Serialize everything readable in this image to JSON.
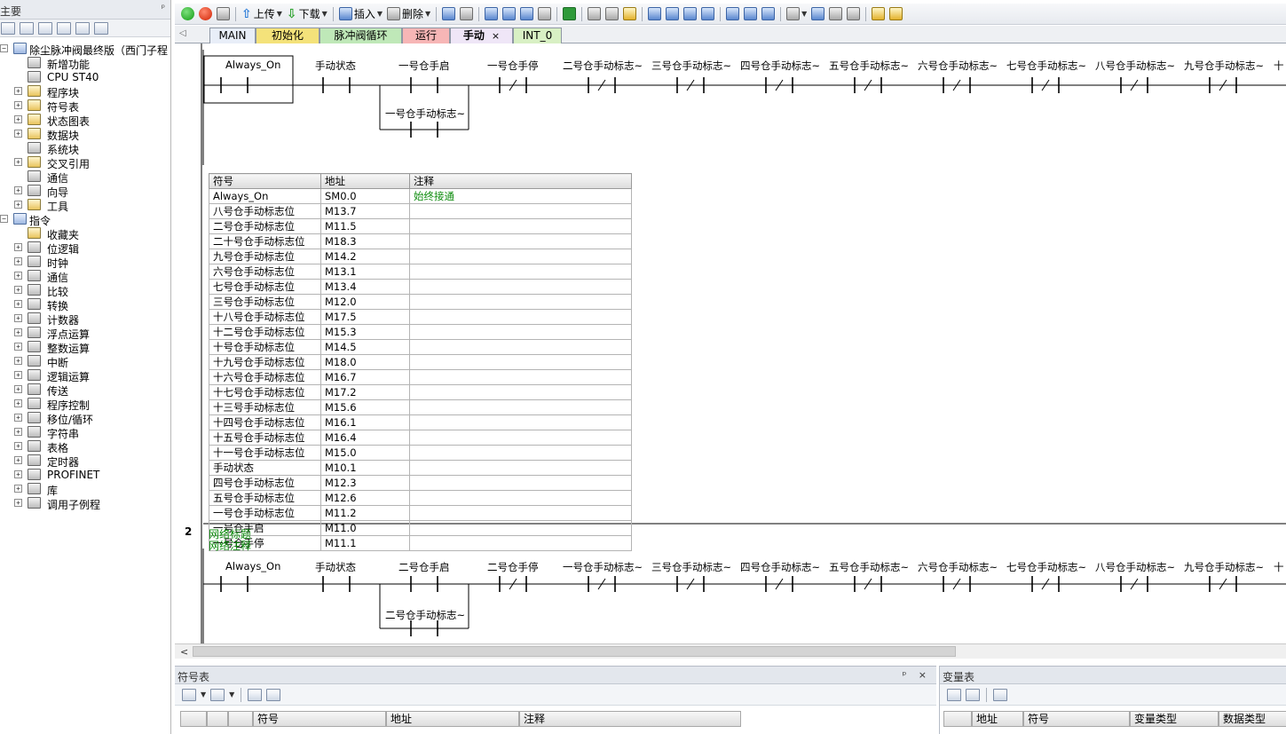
{
  "left_panel": {
    "title": "主要",
    "pin": "ᵖ",
    "tree": [
      {
        "label": "除尘脉冲阀最终版（西门子程",
        "level": 0,
        "expander": "-",
        "icon": "project-icon"
      },
      {
        "label": "新增功能",
        "level": 1,
        "expander": "",
        "icon": "new-feature-icon"
      },
      {
        "label": "CPU ST40",
        "level": 1,
        "expander": "",
        "icon": "cpu-icon"
      },
      {
        "label": "程序块",
        "level": 1,
        "expander": "+",
        "icon": "folder-icon"
      },
      {
        "label": "符号表",
        "level": 1,
        "expander": "+",
        "icon": "folder-icon"
      },
      {
        "label": "状态图表",
        "level": 1,
        "expander": "+",
        "icon": "folder-icon"
      },
      {
        "label": "数据块",
        "level": 1,
        "expander": "+",
        "icon": "folder-icon"
      },
      {
        "label": "系统块",
        "level": 1,
        "expander": "",
        "icon": "system-block-icon"
      },
      {
        "label": "交叉引用",
        "level": 1,
        "expander": "+",
        "icon": "folder-icon"
      },
      {
        "label": "通信",
        "level": 1,
        "expander": "",
        "icon": "communication-icon"
      },
      {
        "label": "向导",
        "level": 1,
        "expander": "+",
        "icon": "wizard-icon"
      },
      {
        "label": "工具",
        "level": 1,
        "expander": "+",
        "icon": "folder-icon"
      },
      {
        "label": "指令",
        "level": 0,
        "expander": "-",
        "icon": "instructions-icon"
      },
      {
        "label": "收藏夹",
        "level": 1,
        "expander": "",
        "icon": "favorites-icon"
      },
      {
        "label": "位逻辑",
        "level": 1,
        "expander": "+",
        "icon": "bit-logic-icon"
      },
      {
        "label": "时钟",
        "level": 1,
        "expander": "+",
        "icon": "clock-icon"
      },
      {
        "label": "通信",
        "level": 1,
        "expander": "+",
        "icon": "communication-icon"
      },
      {
        "label": "比较",
        "level": 1,
        "expander": "+",
        "icon": "compare-icon"
      },
      {
        "label": "转换",
        "level": 1,
        "expander": "+",
        "icon": "convert-icon"
      },
      {
        "label": "计数器",
        "level": 1,
        "expander": "+",
        "icon": "counter-icon"
      },
      {
        "label": "浮点运算",
        "level": 1,
        "expander": "+",
        "icon": "float-math-icon"
      },
      {
        "label": "整数运算",
        "level": 1,
        "expander": "+",
        "icon": "integer-math-icon"
      },
      {
        "label": "中断",
        "level": 1,
        "expander": "+",
        "icon": "interrupt-icon"
      },
      {
        "label": "逻辑运算",
        "level": 1,
        "expander": "+",
        "icon": "logic-op-icon"
      },
      {
        "label": "传送",
        "level": 1,
        "expander": "+",
        "icon": "move-icon"
      },
      {
        "label": "程序控制",
        "level": 1,
        "expander": "+",
        "icon": "program-control-icon"
      },
      {
        "label": "移位/循环",
        "level": 1,
        "expander": "+",
        "icon": "shift-rotate-icon"
      },
      {
        "label": "字符串",
        "level": 1,
        "expander": "+",
        "icon": "string-icon"
      },
      {
        "label": "表格",
        "level": 1,
        "expander": "+",
        "icon": "table-icon"
      },
      {
        "label": "定时器",
        "level": 1,
        "expander": "+",
        "icon": "timer-icon"
      },
      {
        "label": "PROFINET",
        "level": 1,
        "expander": "+",
        "icon": "profinet-icon"
      },
      {
        "label": "库",
        "level": 1,
        "expander": "+",
        "icon": "library-icon"
      },
      {
        "label": "调用子例程",
        "level": 1,
        "expander": "+",
        "icon": "call-subroutine-icon"
      }
    ]
  },
  "toolbar": {
    "upload": "上传",
    "download": "下载",
    "insert": "插入",
    "delete": "删除"
  },
  "tabs": [
    {
      "label": "MAIN",
      "color": "#e8eef8",
      "active": false
    },
    {
      "label": "初始化",
      "color": "#f4e27a",
      "active": false
    },
    {
      "label": "脉冲阀循环",
      "color": "#bfe8b8",
      "active": false
    },
    {
      "label": "运行",
      "color": "#f7b6b6",
      "active": false
    },
    {
      "label": "手动",
      "color": "#efe6f7",
      "active": true,
      "close": "×"
    },
    {
      "label": "INT_0",
      "color": "#d8f0c4",
      "active": false
    }
  ],
  "network1": {
    "contacts": [
      "Always_On",
      "手动状态",
      "一号仓手启",
      "一号仓手停",
      "二号仓手动标志~",
      "三号仓手动标志~",
      "四号仓手动标志~",
      "五号仓手动标志~",
      "六号仓手动标志~",
      "七号仓手动标志~",
      "八号仓手动标志~",
      "九号仓手动标志~",
      "十"
    ],
    "branch": "一号仓手动标志~",
    "symbol_table": {
      "headers": [
        "符号",
        "地址",
        "注释"
      ],
      "rows": [
        [
          "Always_On",
          "SM0.0",
          "始终接通"
        ],
        [
          "八号仓手动标志位",
          "M13.7",
          ""
        ],
        [
          "二号仓手动标志位",
          "M11.5",
          ""
        ],
        [
          "二十号仓手动标志位",
          "M18.3",
          ""
        ],
        [
          "九号仓手动标志位",
          "M14.2",
          ""
        ],
        [
          "六号仓手动标志位",
          "M13.1",
          ""
        ],
        [
          "七号仓手动标志位",
          "M13.4",
          ""
        ],
        [
          "三号仓手动标志位",
          "M12.0",
          ""
        ],
        [
          "十八号仓手动标志位",
          "M17.5",
          ""
        ],
        [
          "十二号仓手动标志位",
          "M15.3",
          ""
        ],
        [
          "十号仓手动标志位",
          "M14.5",
          ""
        ],
        [
          "十九号仓手动标志位",
          "M18.0",
          ""
        ],
        [
          "十六号仓手动标志位",
          "M16.7",
          ""
        ],
        [
          "十七号仓手动标志位",
          "M17.2",
          ""
        ],
        [
          "十三号手动标志位",
          "M15.6",
          ""
        ],
        [
          "十四号仓手动标志位",
          "M16.1",
          ""
        ],
        [
          "十五号仓手动标志位",
          "M16.4",
          ""
        ],
        [
          "十一号仓手动标志位",
          "M15.0",
          ""
        ],
        [
          "手动状态",
          "M10.1",
          ""
        ],
        [
          "四号仓手动标志位",
          "M12.3",
          ""
        ],
        [
          "五号仓手动标志位",
          "M12.6",
          ""
        ],
        [
          "一号仓手动标志位",
          "M11.2",
          ""
        ],
        [
          "一号仓手启",
          "M11.0",
          ""
        ],
        [
          "一号仓手停",
          "M11.1",
          ""
        ]
      ]
    }
  },
  "network2": {
    "number": "2",
    "title": "网络标题",
    "comment": "网络注释",
    "contacts": [
      "Always_On",
      "手动状态",
      "二号仓手启",
      "二号仓手停",
      "一号仓手动标志~",
      "三号仓手动标志~",
      "四号仓手动标志~",
      "五号仓手动标志~",
      "六号仓手动标志~",
      "七号仓手动标志~",
      "八号仓手动标志~",
      "九号仓手动标志~",
      "十"
    ],
    "branch": "二号仓手动标志~"
  },
  "symbol_panel": {
    "title": "符号表",
    "controls": "ᵖ ×",
    "headers": [
      "符号",
      "地址",
      "注释"
    ]
  },
  "variable_panel": {
    "title": "变量表",
    "headers": [
      "地址",
      "符号",
      "变量类型",
      "数据类型"
    ]
  }
}
